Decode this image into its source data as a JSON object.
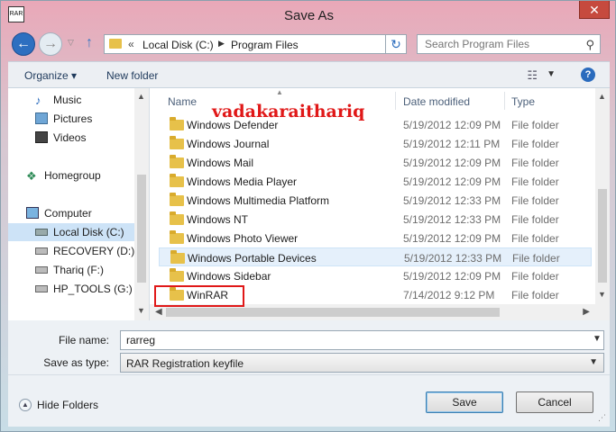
{
  "window": {
    "title": "Save As",
    "app_icon_label": "RAR",
    "close_label": "✕"
  },
  "navigation": {
    "back_label": "←",
    "forward_label": "→",
    "up_label": "↑",
    "refresh_label": "↻",
    "breadcrumb": [
      "Local Disk (C:)",
      "Program Files"
    ],
    "search_placeholder": "Search Program Files"
  },
  "toolbar": {
    "organize_label": "Organize ▾",
    "new_folder_label": "New folder"
  },
  "nav_pane": {
    "items": [
      {
        "label": "Music",
        "icon": "music-icon"
      },
      {
        "label": "Pictures",
        "icon": "pictures-icon"
      },
      {
        "label": "Videos",
        "icon": "videos-icon"
      },
      {
        "label": "Homegroup",
        "icon": "homegroup-icon"
      },
      {
        "label": "Computer",
        "icon": "computer-icon"
      },
      {
        "label": "Local Disk (C:)",
        "icon": "drive-icon"
      },
      {
        "label": "RECOVERY (D:)",
        "icon": "drive-icon"
      },
      {
        "label": "Thariq (F:)",
        "icon": "drive-icon"
      },
      {
        "label": "HP_TOOLS (G:)",
        "icon": "drive-icon"
      }
    ]
  },
  "file_list": {
    "columns": [
      "Name",
      "Date modified",
      "Type"
    ],
    "rows": [
      {
        "name": "Windows Defender",
        "date": "5/19/2012 12:09 PM",
        "type": "File folder"
      },
      {
        "name": "Windows Journal",
        "date": "5/19/2012 12:11 PM",
        "type": "File folder"
      },
      {
        "name": "Windows Mail",
        "date": "5/19/2012 12:09 PM",
        "type": "File folder"
      },
      {
        "name": "Windows Media Player",
        "date": "5/19/2012 12:09 PM",
        "type": "File folder"
      },
      {
        "name": "Windows Multimedia Platform",
        "date": "5/19/2012 12:33 PM",
        "type": "File folder"
      },
      {
        "name": "Windows NT",
        "date": "5/19/2012 12:33 PM",
        "type": "File folder"
      },
      {
        "name": "Windows Photo Viewer",
        "date": "5/19/2012 12:09 PM",
        "type": "File folder"
      },
      {
        "name": "Windows Portable Devices",
        "date": "5/19/2012 12:33 PM",
        "type": "File folder"
      },
      {
        "name": "Windows Sidebar",
        "date": "5/19/2012 12:09 PM",
        "type": "File folder"
      },
      {
        "name": "WinRAR",
        "date": "7/14/2012 9:12 PM",
        "type": "File folder"
      }
    ],
    "selected_row": "Windows Portable Devices"
  },
  "annotation": {
    "watermark_text": "vadakaraithariq",
    "highlight_color": "#e01818"
  },
  "form": {
    "filename_label": "File name:",
    "filename_value": "rarreg",
    "savetype_label": "Save as type:",
    "savetype_value": "RAR Registration keyfile"
  },
  "buttons": {
    "hide_folders_label": "Hide Folders",
    "save_label": "Save",
    "cancel_label": "Cancel"
  },
  "colors": {
    "accent": "#2d6fc0",
    "folder": "#e7c14a",
    "selection": "#cde3f7"
  }
}
